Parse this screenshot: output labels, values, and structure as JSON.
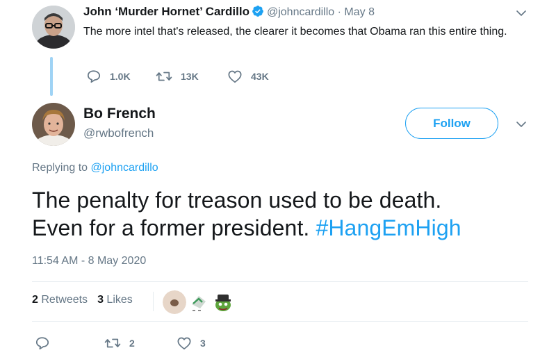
{
  "parent_tweet": {
    "author_name": "John ‘Murder Hornet’ Cardillo",
    "handle": "@johncardillo",
    "separator": "·",
    "date": "May 8",
    "text": "The more intel that's released, the clearer it becomes that Obama ran this entire thing.",
    "replies": "1.0K",
    "retweets": "13K",
    "likes": "43K"
  },
  "main_tweet": {
    "author_name": "Bo French",
    "handle": "@rwbofrench",
    "follow_label": "Follow",
    "replying_prefix": "Replying to",
    "replying_handle": "@johncardillo",
    "text_line1": "The penalty for treason used to be death.",
    "text_line2": "Even for a former president.",
    "hashtag": "#HangEmHigh",
    "timestamp": "11:54 AM - 8 May 2020",
    "retweet_count": "2",
    "retweet_label": "Retweets",
    "like_count": "3",
    "like_label": "Likes",
    "bottom_retweets": "2",
    "bottom_likes": "3"
  },
  "colors": {
    "accent": "#1da1f2",
    "muted": "#657786",
    "text": "#14171a",
    "thread_line": "#9fd3f5"
  },
  "icons": [
    "verified-badge-icon",
    "chevron-down-icon",
    "reply-icon",
    "retweet-icon",
    "like-icon"
  ]
}
